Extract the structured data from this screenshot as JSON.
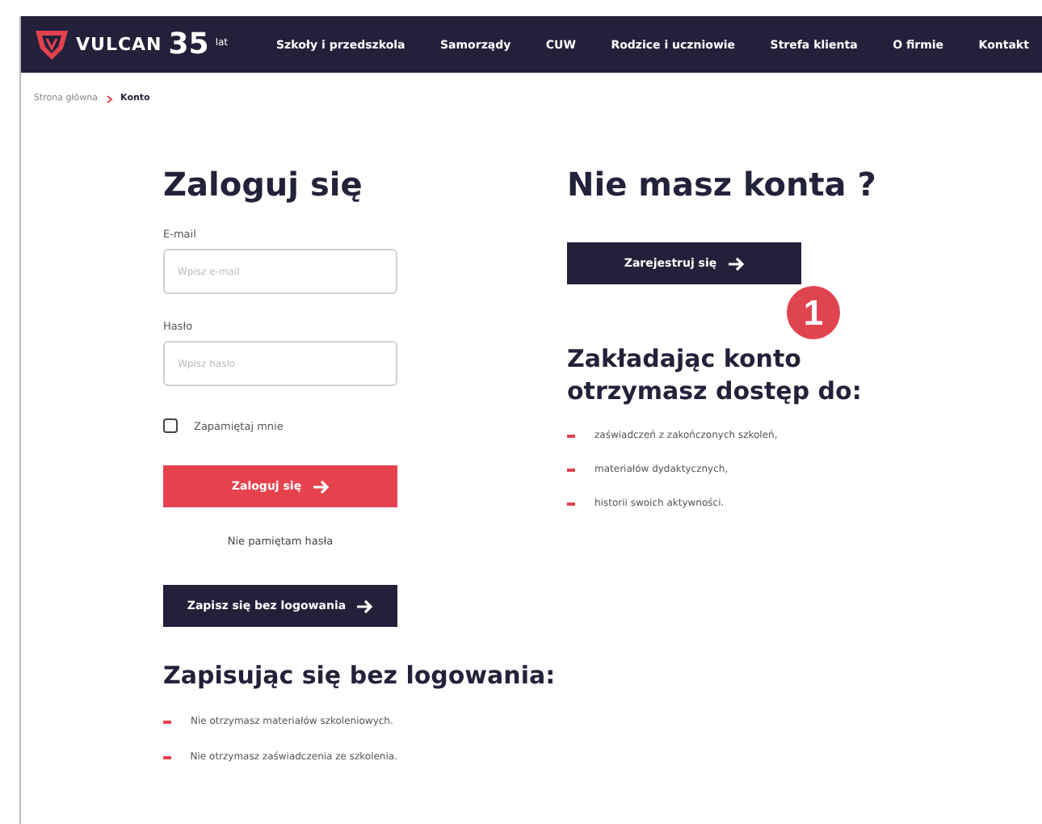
{
  "header": {
    "logo": {
      "name": "VULCAN",
      "anniversary": "35",
      "anniversary_unit": "lat"
    },
    "nav": [
      "Szkoły i przedszkola",
      "Samorządy",
      "CUW",
      "Rodzice i uczniowie",
      "Strefa klienta",
      "O firmie",
      "Kontakt"
    ]
  },
  "breadcrumb": [
    {
      "label": "Strona główna",
      "selected": false
    },
    {
      "label": "Konto",
      "selected": true
    }
  ],
  "login": {
    "title": "Zaloguj się",
    "fields": [
      {
        "label": "E-mail",
        "placeholder": "Wpisz e-mail"
      },
      {
        "label": "Hasło",
        "placeholder": "Wpisz hasło"
      }
    ],
    "remember": {
      "label": "Zapamiętaj mnie",
      "checked": false
    },
    "submit": "Zaloguj się",
    "forgot": "Nie pamiętam hasła",
    "guest_button": "Zapisz się bez logowania",
    "guest_title": "Zapisując się bez logowania:",
    "guest_items": [
      "Nie otrzymasz materiałów szkoleniowych.",
      "Nie otrzymasz zaświadczenia ze szkolenia."
    ]
  },
  "register": {
    "title": "Nie masz konta ?",
    "button": "Zarejestruj się",
    "badge": "1",
    "benefits_title": "Zakładając konto otrzymasz dostęp do:",
    "benefits": [
      "zaświadczeń z zakończonych szkoleń,",
      "materiałów dydaktycznych,",
      "historii swoich aktywności."
    ]
  }
}
